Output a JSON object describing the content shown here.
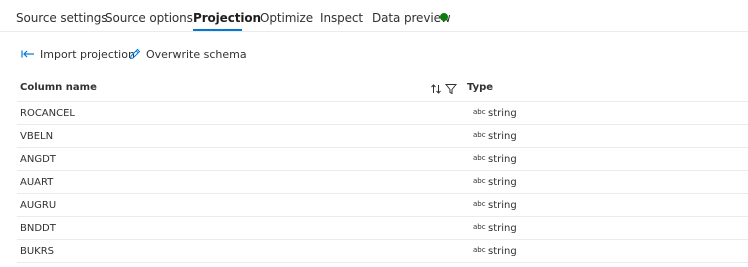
{
  "tabs": [
    {
      "label": "Source settings",
      "active": false
    },
    {
      "label": "Source options",
      "active": false
    },
    {
      "label": "Projection",
      "active": true
    },
    {
      "label": "Optimize",
      "active": false
    },
    {
      "label": "Inspect",
      "active": false
    },
    {
      "label": "Data preview",
      "active": false,
      "status": "green-dot"
    }
  ],
  "toolbar": {
    "import_label": "Import projection",
    "import_icon": "import-arrow-icon",
    "overwrite_label": "Overwrite schema",
    "overwrite_icon": "pencil-icon"
  },
  "grid": {
    "col_name_header": "Column name",
    "col_type_header": "Type",
    "sort_icon": "sort-icon",
    "filter_icon": "filter-icon",
    "rows": [
      {
        "name": "ROCANCEL",
        "type_badge": "abc",
        "type": "string"
      },
      {
        "name": "VBELN",
        "type_badge": "abc",
        "type": "string"
      },
      {
        "name": "ANGDT",
        "type_badge": "abc",
        "type": "string"
      },
      {
        "name": "AUART",
        "type_badge": "abc",
        "type": "string"
      },
      {
        "name": "AUGRU",
        "type_badge": "abc",
        "type": "string"
      },
      {
        "name": "BNDDT",
        "type_badge": "abc",
        "type": "string"
      },
      {
        "name": "BUKRS",
        "type_badge": "abc",
        "type": "string"
      }
    ]
  },
  "colors": {
    "accent": "#0078d4",
    "status_ok": "#107c10",
    "divider": "#edebe9"
  }
}
